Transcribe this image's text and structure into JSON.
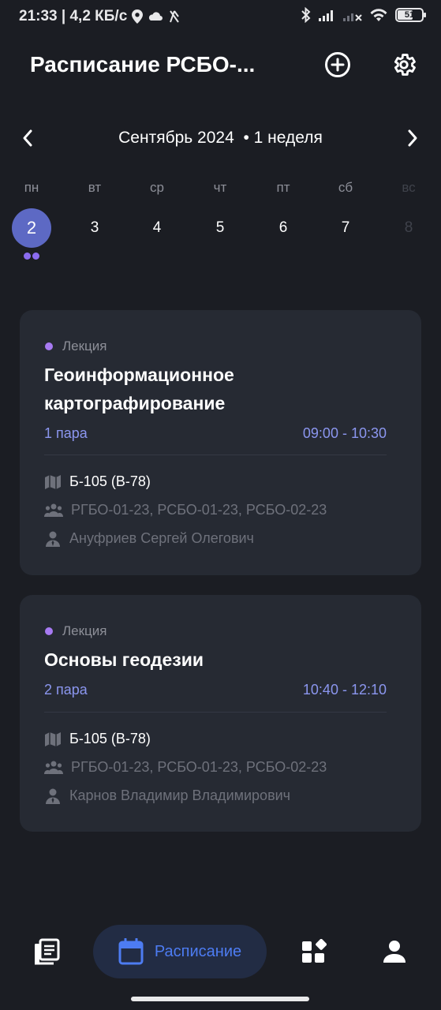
{
  "status_bar": {
    "time_and_speed": "21:33 | 4,2 КБ/с",
    "battery": "51"
  },
  "header": {
    "title": "Расписание РСБО-..."
  },
  "calendar": {
    "month_label": "Сентябрь 2024",
    "week_label": "• 1 неделя",
    "weekdays": [
      "пн",
      "вт",
      "ср",
      "чт",
      "пт",
      "сб",
      "вс"
    ],
    "dates": [
      "2",
      "3",
      "4",
      "5",
      "6",
      "7",
      "8"
    ],
    "selected_index": 0
  },
  "lessons": [
    {
      "type": "Лекция",
      "subject": "Геоинформационное картографирование",
      "pair": "1 пара",
      "time": "09:00 - 10:30",
      "room": "Б-105 (В-78)",
      "groups": "РГБО-01-23, РСБО-01-23, РСБО-02-23",
      "teacher": "Ануфриев Сергей Олегович"
    },
    {
      "type": "Лекция",
      "subject": "Основы геодезии",
      "pair": "2 пара",
      "time": "10:40 - 12:10",
      "room": "Б-105 (В-78)",
      "groups": "РГБО-01-23, РСБО-01-23, РСБО-02-23",
      "teacher": "Карнов Владимир Владимирович"
    }
  ],
  "bottom_nav": {
    "items": [
      {
        "icon": "news-icon"
      },
      {
        "icon": "calendar-icon",
        "label": "Расписание"
      },
      {
        "icon": "services-icon"
      },
      {
        "icon": "profile-icon"
      }
    ]
  },
  "colors": {
    "background": "#1b1d23",
    "card": "#262a33",
    "accent": "#5d69c4",
    "pair_text": "#8b96ef",
    "lesson_dot": "#a77af2",
    "nav_active": "#4d7cf2"
  }
}
